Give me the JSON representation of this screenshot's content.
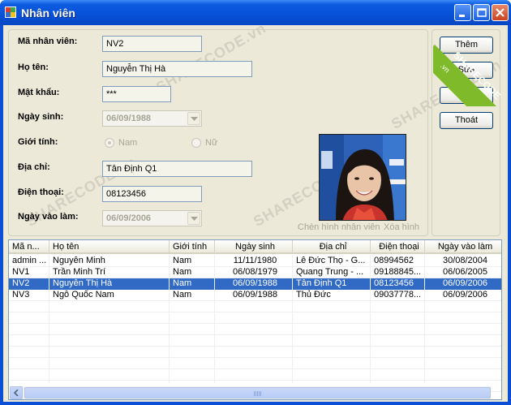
{
  "window": {
    "title": "Nhân viên"
  },
  "form": {
    "labels": {
      "employee_id": "Mã nhân viên:",
      "full_name": "Họ tên:",
      "password": "Mật khẩu:",
      "birth_date": "Ngày sinh:",
      "gender": "Giới tính:",
      "address": "Địa chỉ:",
      "phone": "Điện thoại:",
      "hire_date": "Ngày vào làm:"
    },
    "values": {
      "employee_id": "NV2",
      "full_name": "Nguyễn Thị Hà",
      "password": "***",
      "birth_date": "06/09/1988",
      "address": "Tân Định Q1",
      "phone": "08123456",
      "hire_date": "06/09/2006"
    },
    "gender_options": {
      "male": "Nam",
      "female": "Nữ",
      "selected": "Nam"
    },
    "photo_links": {
      "insert": "Chèn hình nhân viên",
      "delete": "Xóa hình"
    }
  },
  "buttons": {
    "add": "Thêm",
    "edit": "Sửa",
    "delete": "Xóa",
    "exit": "Thoát"
  },
  "grid": {
    "columns": [
      "Mã n...",
      "Họ tên",
      "Giới tính",
      "Ngày sinh",
      "Địa chỉ",
      "Điện thoại",
      "Ngày vào làm"
    ],
    "rows": [
      [
        "admin ...",
        "Nguyễn Minh",
        "Nam",
        "11/11/1980",
        "Lê Đức Thọ - G...",
        "08994562",
        "30/08/2004"
      ],
      [
        "NV1",
        "Trần Minh Trí",
        "Nam",
        "06/08/1979",
        "Quang Trung - ...",
        "09188845...",
        "06/06/2005"
      ],
      [
        "NV2",
        "Nguyễn Thị Hà",
        "Nam",
        "06/09/1988",
        "Tân Định Q1",
        "08123456",
        "06/09/2006"
      ],
      [
        "NV3",
        "Ngô Quốc Nam",
        "Nam",
        "06/09/1988",
        "Thủ Đức",
        "09037778...",
        "06/09/2006"
      ]
    ],
    "selected_row": 2
  },
  "watermark": {
    "text": "SHARECODE.vn",
    "banner": "SHARECODE",
    "banner_sub": ".vn"
  },
  "colors": {
    "title_bar": "#0652d9",
    "selection": "#316ac5",
    "form_bg": "#ece9d8",
    "banner": "#7fba2b"
  }
}
